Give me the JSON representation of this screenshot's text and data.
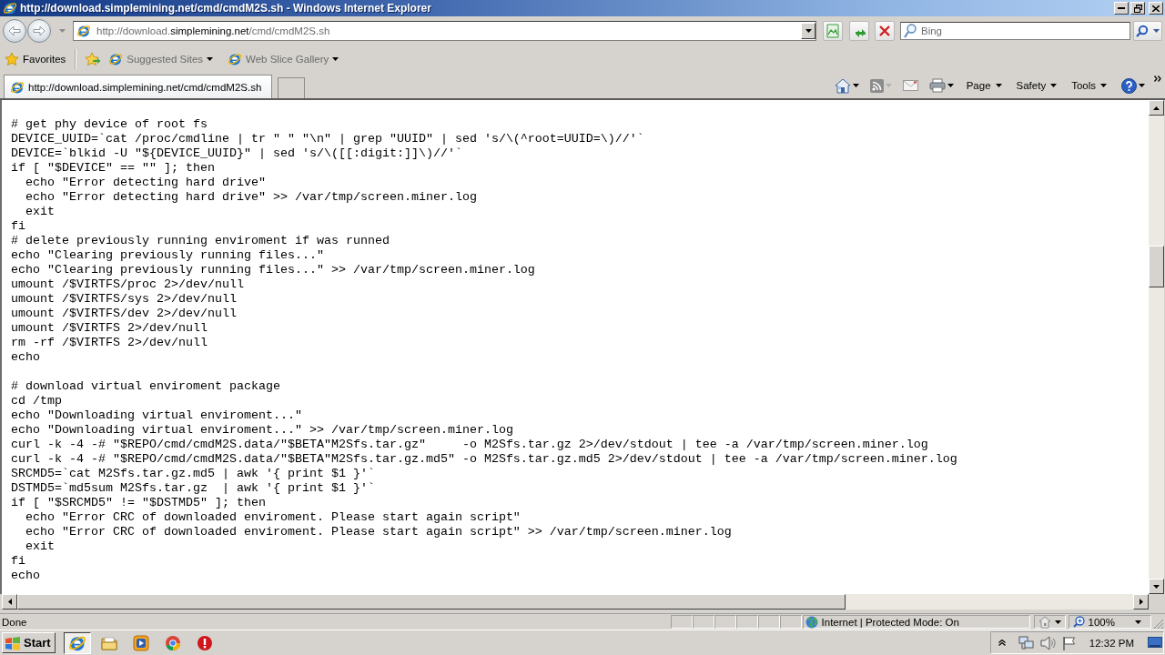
{
  "window": {
    "title": "http://download.simplemining.net/cmd/cmdM2S.sh - Windows Internet Explorer"
  },
  "address_bar": {
    "url": [
      {
        "text": "http://download.",
        "emphasis": false
      },
      {
        "text": "simplemining.net",
        "emphasis": true
      },
      {
        "text": "/cmd/cmdM2S.sh",
        "emphasis": false
      }
    ]
  },
  "search": {
    "placeholder": "Bing"
  },
  "favorites_bar": {
    "label": "Favorites",
    "links": [
      {
        "label": "Suggested Sites"
      },
      {
        "label": "Web Slice Gallery"
      }
    ]
  },
  "tabs": [
    {
      "label": "http://download.simplemining.net/cmd/cmdM2S.sh",
      "selected": true
    }
  ],
  "command_bar": {
    "menus": [
      {
        "label": "Page"
      },
      {
        "label": "Safety"
      },
      {
        "label": "Tools"
      }
    ]
  },
  "code_blocks": [
    {
      "lines": [
        "# get phy device of root fs",
        "DEVICE_UUID=`cat /proc/cmdline | tr \" \" \"\\n\" | grep \"UUID\" | sed 's/\\(^root=UUID=\\)//'`",
        "DEVICE=`blkid -U \"${DEVICE_UUID}\" | sed 's/\\([[:digit:]]\\)//'`",
        "if [ \"$DEVICE\" == \"\" ]; then",
        "  echo \"Error detecting hard drive\"",
        "  echo \"Error detecting hard drive\" >> /var/tmp/screen.miner.log",
        "  exit",
        "fi",
        "# delete previously running enviroment if was runned",
        "echo \"Clearing previously running files...\"",
        "echo \"Clearing previously running files...\" >> /var/tmp/screen.miner.log",
        "umount /$VIRTFS/proc 2>/dev/null",
        "umount /$VIRTFS/sys 2>/dev/null",
        "umount /$VIRTFS/dev 2>/dev/null",
        "umount /$VIRTFS 2>/dev/null",
        "rm -rf /$VIRTFS 2>/dev/null",
        "echo"
      ]
    },
    {
      "lines": [
        "# download virtual enviroment package",
        "cd /tmp",
        "echo \"Downloading virtual enviroment...\"",
        "echo \"Downloading virtual enviroment...\" >> /var/tmp/screen.miner.log",
        "curl -k -4 -# \"$REPO/cmd/cmdM2S.data/\"$BETA\"M2Sfs.tar.gz\"     -o M2Sfs.tar.gz 2>/dev/stdout | tee -a /var/tmp/screen.miner.log",
        "curl -k -4 -# \"$REPO/cmd/cmdM2S.data/\"$BETA\"M2Sfs.tar.gz.md5\" -o M2Sfs.tar.gz.md5 2>/dev/stdout | tee -a /var/tmp/screen.miner.log",
        "SRCMD5=`cat M2Sfs.tar.gz.md5 | awk '{ print $1 }'`",
        "DSTMD5=`md5sum M2Sfs.tar.gz  | awk '{ print $1 }'`",
        "if [ \"$SRCMD5\" != \"$DSTMD5\" ]; then",
        "  echo \"Error CRC of downloaded enviroment. Please start again script\"",
        "  echo \"Error CRC of downloaded enviroment. Please start again script\" >> /var/tmp/screen.miner.log",
        "  exit",
        "fi",
        "echo"
      ]
    }
  ],
  "status_bar": {
    "status": "Done",
    "zone": "Internet | Protected Mode: On",
    "zoom": "100%"
  },
  "taskbar": {
    "start": "Start",
    "apps": [
      {
        "kind": "browser",
        "selected": true
      },
      {
        "kind": "folder",
        "selected": false
      },
      {
        "kind": "media",
        "selected": false
      },
      {
        "kind": "chrome",
        "selected": false
      },
      {
        "kind": "stop",
        "selected": false
      }
    ],
    "clock": "12:32 PM"
  }
}
